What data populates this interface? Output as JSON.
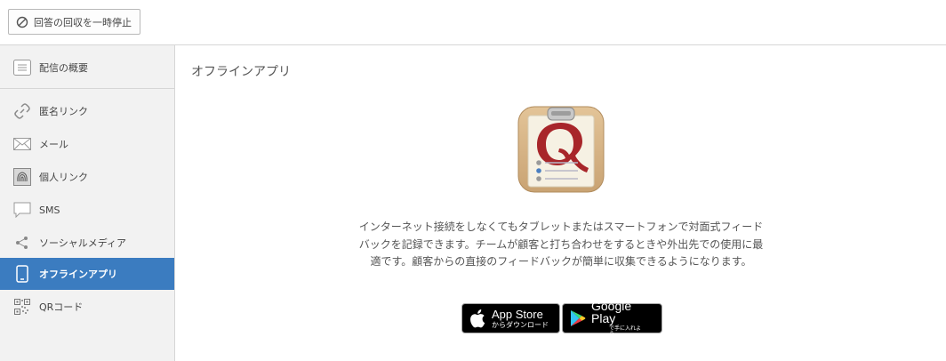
{
  "toolbar": {
    "pause_label": "回答の回収を一時停止",
    "pause_icon": "ban-icon"
  },
  "sidebar": {
    "overview": {
      "label": "配信の概要",
      "icon": "list-icon"
    },
    "items": [
      {
        "label": "匿名リンク",
        "icon": "link-icon"
      },
      {
        "label": "メール",
        "icon": "envelope-icon"
      },
      {
        "label": "個人リンク",
        "icon": "fingerprint-icon"
      },
      {
        "label": "SMS",
        "icon": "chat-bubble-icon"
      },
      {
        "label": "ソーシャルメディア",
        "icon": "share-icon"
      },
      {
        "label": "オフラインアプリ",
        "icon": "tablet-icon",
        "active": true
      },
      {
        "label": "QRコード",
        "icon": "qr-code-icon"
      }
    ],
    "active_color": "#3b7cc0"
  },
  "main": {
    "title": "オフラインアプリ",
    "app_icon": "clipboard-q-app-icon",
    "description": "インターネット接続をしなくてもタブレットまたはスマートフォンで対面式フィードバックを記録できます。チームが顧客と打ち合わせをするときや外出先での使用に最適です。顧客からの直接のフィードバックが簡単に収集できるようになります。",
    "app_store": {
      "title": "App Store",
      "subtitle": "からダウンロード"
    },
    "google_play": {
      "title": "Google Play",
      "subtitle": "で手に入れよう"
    }
  }
}
